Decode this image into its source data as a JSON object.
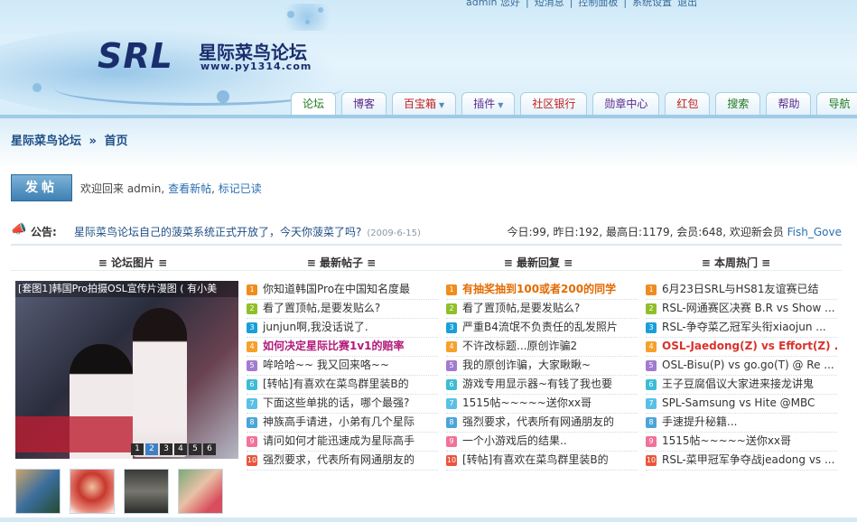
{
  "colors": {
    "nav_bg": "#9fcbe6",
    "link": "#2a6fb0",
    "crumb": "#1f4f86",
    "hot_red": "#d9322b",
    "hot_orange": "#e46a00",
    "hot_purple": "#b2197a"
  },
  "logo": {
    "main": "SRL",
    "cn": "星际菜鸟论坛",
    "url": "www.py1314.com"
  },
  "top_links": [
    "admin 您好",
    "|",
    "短消息",
    "|",
    "控制面板",
    "|",
    "系统设置",
    "退出"
  ],
  "nav": [
    {
      "label": "论坛",
      "color": "#1f7a1f",
      "caret": false,
      "active": true
    },
    {
      "label": "博客",
      "color": "#5a2a8a",
      "caret": false,
      "active": false
    },
    {
      "label": "百宝箱",
      "color": "#c02020",
      "caret": true,
      "active": false
    },
    {
      "label": "插件",
      "color": "#5a2a8a",
      "caret": true,
      "active": false
    },
    {
      "label": "社区银行",
      "color": "#c02020",
      "caret": false,
      "active": false
    },
    {
      "label": "勋章中心",
      "color": "#5a2a8a",
      "caret": false,
      "active": false
    },
    {
      "label": "红包",
      "color": "#c02020",
      "caret": false,
      "active": false
    },
    {
      "label": "搜索",
      "color": "#1f7a1f",
      "caret": false,
      "active": false
    },
    {
      "label": "帮助",
      "color": "#5a2a8a",
      "caret": false,
      "active": false
    },
    {
      "label": "导航",
      "color": "#1f7a1f",
      "caret": false,
      "active": false
    }
  ],
  "breadcrumb": {
    "site": "星际菜鸟论坛",
    "sep": "»",
    "page": "首页"
  },
  "post_button": "发帖",
  "welcome": {
    "prefix": "欢迎回来 admin,",
    "new_posts": "查看新帖",
    "comma": ",",
    "mark_read": "标记已读"
  },
  "notice": {
    "label": "公告:",
    "text": "星际菜鸟论坛自己的菠菜系统正式开放了，今天你菠菜了吗?",
    "date": "(2009-6-15)",
    "stats": "今日:99, 昨日:192, 最高日:1179, 会员:648, 欢迎新会员 ",
    "new_member": "Fish_Gove"
  },
  "columns": {
    "pics": "≡ 论坛图片 ≡",
    "latest": "≡ 最新帖子 ≡",
    "replies": "≡ 最新回复 ≡",
    "hot": "≡ 本周热门 ≡"
  },
  "photo": {
    "caption": "[套图1]韩国Pro拍摄OSL宣传片漫图 ( 有小美",
    "pages": [
      "1",
      "2",
      "3",
      "4",
      "5",
      "6"
    ]
  },
  "latest_posts": [
    {
      "n": "1",
      "text": "你知道韩国Pro在中国知名度最",
      "style": ""
    },
    {
      "n": "2",
      "text": "看了置顶帖,是要发贴么?",
      "style": ""
    },
    {
      "n": "3",
      "text": "junjun啊,我没话说了.",
      "style": ""
    },
    {
      "n": "4",
      "text": "如何决定星际比赛1v1的赔率",
      "style": "hot-p"
    },
    {
      "n": "5",
      "text": "哞哈哈~~ 我又回来咯~~",
      "style": ""
    },
    {
      "n": "6",
      "text": "[转帖]有喜欢在菜鸟群里装B的",
      "style": ""
    },
    {
      "n": "7",
      "text": "下面这些单挑的话，哪个最强?",
      "style": ""
    },
    {
      "n": "8",
      "text": "神族高手请进，小弟有几个星际",
      "style": ""
    },
    {
      "n": "9",
      "text": "请问如何才能迅速成为星际高手",
      "style": ""
    },
    {
      "n": "10",
      "text": "强烈要求，代表所有网通朋友的",
      "style": ""
    }
  ],
  "latest_replies": [
    {
      "n": "1",
      "text": "有抽奖抽到100或者200的同学",
      "style": "hot-o"
    },
    {
      "n": "2",
      "text": "看了置顶帖,是要发贴么?",
      "style": ""
    },
    {
      "n": "3",
      "text": "严重B4流氓不负责任的乱发照片",
      "style": ""
    },
    {
      "n": "4",
      "text": "不许改标题...原创诈骗2",
      "style": ""
    },
    {
      "n": "5",
      "text": "我的原创诈骗，大家瞅瞅~",
      "style": ""
    },
    {
      "n": "6",
      "text": "游戏专用显示器~有钱了我也要",
      "style": ""
    },
    {
      "n": "7",
      "text": "1515帖~~~~~送你xx哥",
      "style": ""
    },
    {
      "n": "8",
      "text": "强烈要求，代表所有网通朋友的",
      "style": ""
    },
    {
      "n": "9",
      "text": "一个小游戏后的结果..",
      "style": ""
    },
    {
      "n": "10",
      "text": "[转帖]有喜欢在菜鸟群里装B的",
      "style": ""
    }
  ],
  "weekly_hot": [
    {
      "n": "1",
      "text": "6月23日SRL与HS81友谊赛已结",
      "style": ""
    },
    {
      "n": "2",
      "text": "RSL-网通赛区决赛 B.R vs Show ...",
      "style": ""
    },
    {
      "n": "3",
      "text": "RSL-争夺菜乙冠军头衔xiaojun ...",
      "style": ""
    },
    {
      "n": "4",
      "text": "OSL-Jaedong(Z) vs Effort(Z) ...",
      "style": "hot-r"
    },
    {
      "n": "5",
      "text": "OSL-Bisu(P) vs go.go(T) @ Re ...",
      "style": ""
    },
    {
      "n": "6",
      "text": "王子豆腐倡议大家进来接龙讲鬼",
      "style": ""
    },
    {
      "n": "7",
      "text": "SPL-Samsung vs Hite @MBC",
      "style": ""
    },
    {
      "n": "8",
      "text": "手速提升秘籍...",
      "style": ""
    },
    {
      "n": "9",
      "text": "1515帖~~~~~送你xx哥",
      "style": ""
    },
    {
      "n": "10",
      "text": "RSL-菜甲冠军争夺战jeadong vs ...",
      "style": ""
    }
  ]
}
